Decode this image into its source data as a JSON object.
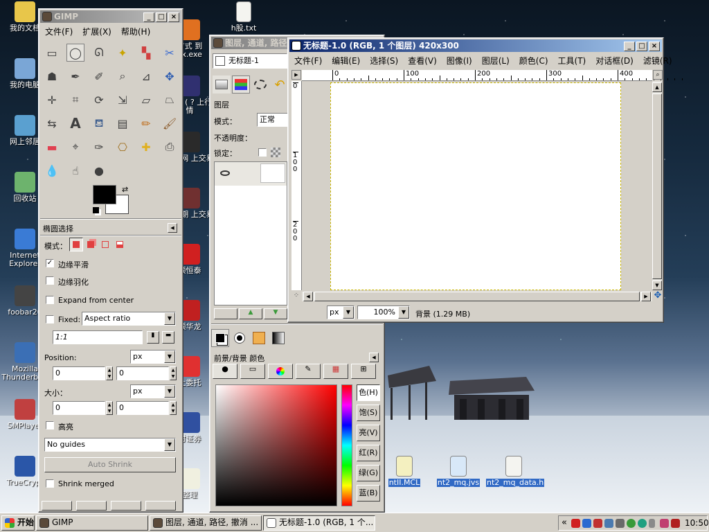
{
  "desktop": {
    "icons_left": [
      {
        "label": "我的文档",
        "color": "#e8c64a"
      },
      {
        "label": "我的电脑",
        "color": "#7aa6d6"
      },
      {
        "label": "网上邻居",
        "color": "#5aa0d0"
      },
      {
        "label": "回收站",
        "color": "#6db36d"
      },
      {
        "label": "Internet Explorer",
        "color": "#3a7bd5"
      },
      {
        "label": "foobar20",
        "color": "#444444"
      },
      {
        "label": "Mozilla Thunderbird",
        "color": "#3b6fb5"
      },
      {
        "label": "SMPlayer",
        "color": "#c04040"
      },
      {
        "label": "TrueCrypt",
        "color": "#2a56a8"
      }
    ],
    "icons_col2": [
      {
        "label": "方式 到 ox.exe",
        "color": "#e07020"
      },
      {
        "label": "中期 ( ? 上行情",
        "color": "#303070"
      },
      {
        "label": "中期网 上交易",
        "color": "#2a2a2a"
      },
      {
        "label": "金融期 上交易",
        "color": "#703030"
      },
      {
        "label": "顺恒泰",
        "color": "#d02020"
      },
      {
        "label": "顺华龙",
        "color": "#c02020"
      },
      {
        "label": "上委托",
        "color": "#e03030"
      },
      {
        "label": "时证券",
        "color": "#3050a0"
      },
      {
        "label": "整理",
        "color": "#f0f0e0"
      }
    ],
    "top_file": "h股.txt",
    "files": [
      {
        "label": "ntII.MCL",
        "color": "#f4f0c0"
      },
      {
        "label": "nt2_mq.jvs",
        "color": "#d8e8f8"
      },
      {
        "label": "nt2_mq_data.h",
        "color": "#f4f4f0"
      }
    ]
  },
  "toolbox": {
    "title": "GIMP",
    "menu": [
      "文件(F)",
      "扩展(X)",
      "帮助(H)"
    ],
    "tool_icons": [
      "rect-select-icon",
      "ellipse-select-icon",
      "free-select-icon",
      "fuzzy-select-icon",
      "color-select-icon",
      "scissors-icon",
      "foreground-select-icon",
      "paths-icon",
      "color-picker-icon",
      "zoom-icon",
      "measure-icon",
      "move-icon",
      "align-icon",
      "crop-icon",
      "rotate-icon",
      "scale-icon",
      "shear-icon",
      "perspective-icon",
      "flip-icon",
      "text-icon",
      "bucket-fill-icon",
      "blend-icon",
      "pencil-icon",
      "paintbrush-icon",
      "eraser-icon",
      "airbrush-icon",
      "ink-icon",
      "clone-icon",
      "heal-icon",
      "perspective-clone-icon",
      "blur-icon",
      "smudge-icon",
      "dodge-burn-icon"
    ],
    "options_title": "椭圆选择",
    "mode_label": "模式：",
    "antialias_label": "边缘平滑",
    "feather_label": "边缘羽化",
    "expand_label": "Expand from center",
    "fixed_label": "Fixed:",
    "fixed_value": "Aspect ratio",
    "ratio_value": "1:1",
    "position_label": "Position:",
    "position_unit": "px",
    "pos_x": "0",
    "pos_y": "0",
    "size_label": "大小：",
    "size_unit": "px",
    "size_x": "0",
    "size_y": "0",
    "highlight_label": "高亮",
    "guides_value": "No guides",
    "auto_shrink": "Auto Shrink",
    "shrink_merged": "Shrink merged",
    "fg_color": "#000000",
    "bg_color": "#ffffff"
  },
  "layers": {
    "title": "图层, 通道, 路径, 撤消 -",
    "image_name": "无标题-1",
    "section_label": "图层",
    "mode_label": "模式：",
    "mode_value": "正常",
    "opacity_label": "不透明度：",
    "lock_label": "锁定：",
    "fgbg_title": "前景/背景  颜色",
    "channels": [
      "色(H)",
      "饱(S)",
      "亮(V)",
      "红(R)",
      "绿(G)",
      "蓝(B)"
    ]
  },
  "image_window": {
    "title": "无标题-1.0 (RGB, 1 个图层) 420x300",
    "menu": [
      "文件(F)",
      "编辑(E)",
      "选择(S)",
      "查看(V)",
      "图像(I)",
      "图层(L)",
      "颜色(C)",
      "工具(T)",
      "对话框(D)",
      "滤镜(R)"
    ],
    "ruler_h": [
      "0",
      "100",
      "200",
      "300",
      "400"
    ],
    "ruler_v": [
      "0",
      "1 0 0",
      "2 0 0"
    ],
    "unit": "px",
    "zoom": "100%",
    "status": "背景 (1.29 MB)"
  },
  "taskbar": {
    "start": "开始",
    "buttons": [
      "GIMP",
      "图层, 通道, 路径, 撤消 ...",
      "无标题-1.0 (RGB, 1 个..."
    ],
    "tray_chevron": "«",
    "clock": "10:50"
  }
}
